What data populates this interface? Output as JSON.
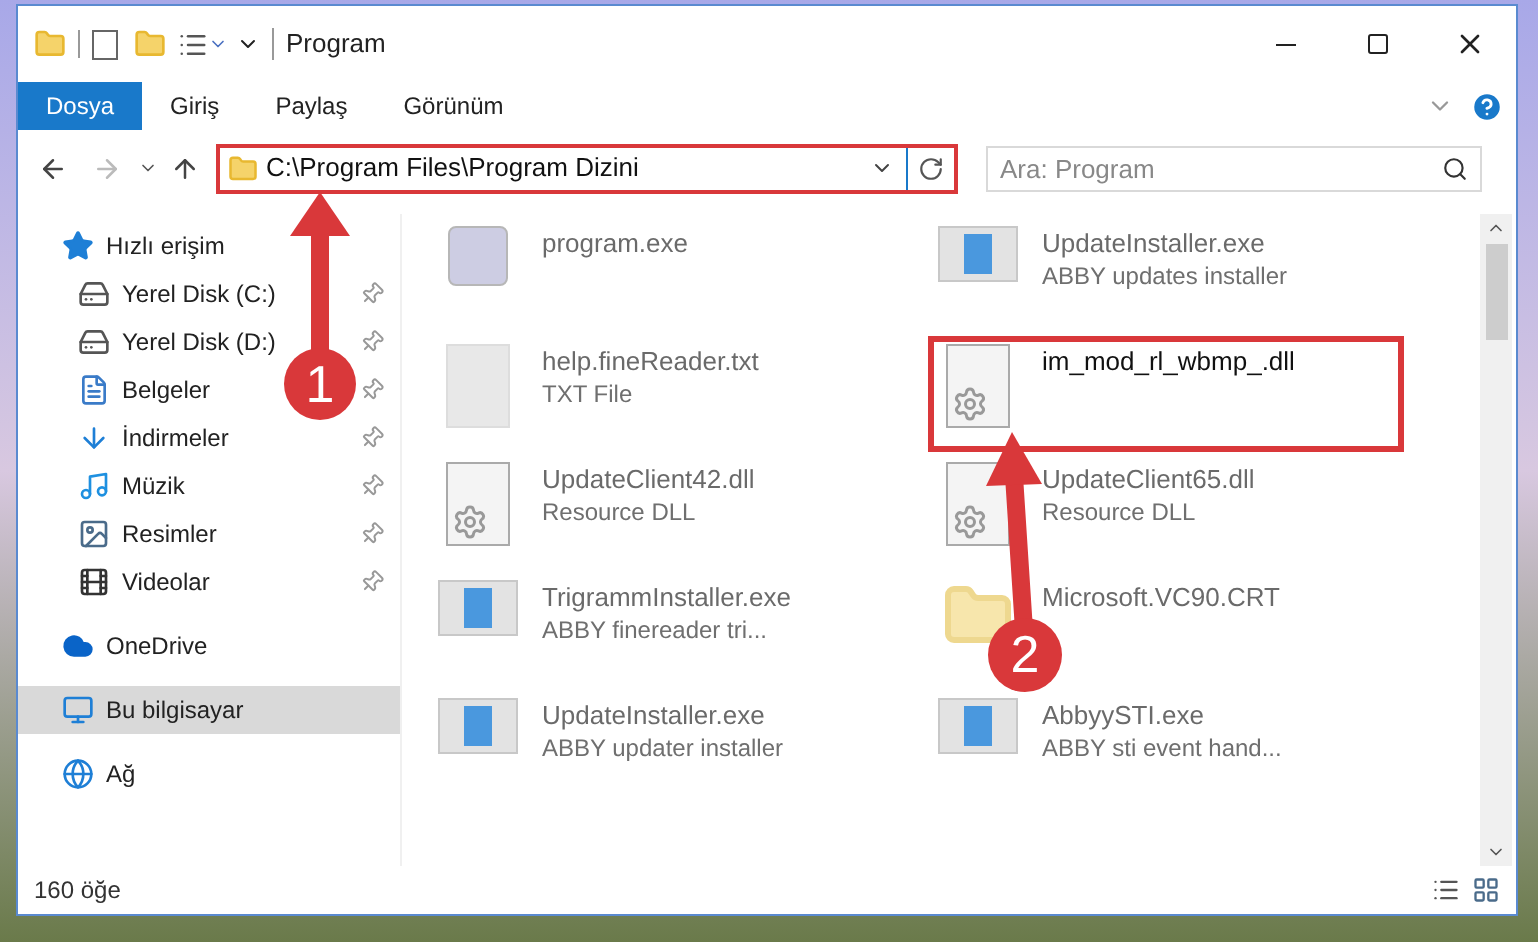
{
  "window": {
    "title": "Program"
  },
  "ribbon_tabs": [
    {
      "label": "Dosya",
      "selected": true
    },
    {
      "label": "Giriş",
      "selected": false
    },
    {
      "label": "Paylaş",
      "selected": false
    },
    {
      "label": "Görünüm",
      "selected": false
    }
  ],
  "address": {
    "path": "C:\\Program Files\\Program Dizini",
    "marked": true
  },
  "search": {
    "placeholder": "Ara: Program"
  },
  "nav": [
    {
      "label": "Hızlı erişim",
      "kind": "star",
      "selected": false,
      "children": [
        {
          "label": "Yerel Disk (C:)",
          "kind": "drive",
          "pinned": true,
          "selected": false
        },
        {
          "label": "Yerel Disk (D:)",
          "kind": "drive",
          "pinned": true,
          "selected": false
        },
        {
          "label": "Belgeler",
          "kind": "document",
          "pinned": true,
          "selected": false
        },
        {
          "label": "İndirmeler",
          "kind": "download",
          "pinned": true,
          "selected": false
        },
        {
          "label": "Müzik",
          "kind": "music",
          "pinned": true,
          "selected": false
        },
        {
          "label": "Resimler",
          "kind": "picture",
          "pinned": true,
          "selected": false
        },
        {
          "label": "Videolar",
          "kind": "film",
          "pinned": true,
          "selected": false
        }
      ]
    },
    {
      "label": "OneDrive",
      "kind": "cloud",
      "selected": false
    },
    {
      "label": "Bu bilgisayar",
      "kind": "computer",
      "selected": true
    },
    {
      "label": "Ağ",
      "kind": "network",
      "selected": false
    }
  ],
  "files": [
    {
      "name": "program.exe",
      "kind": "app",
      "marked": false
    },
    {
      "name": "UpdateInstaller.exe",
      "type": "ABBY updates installer",
      "kind": "installer",
      "marked": false
    },
    {
      "name": "help.fineReader.txt",
      "type": "TXT File",
      "kind": "text",
      "marked": false
    },
    {
      "name": "im_mod_rl_wbmp_.dll",
      "kind": "dll",
      "marked": true
    },
    {
      "name": "UpdateClient42.dll",
      "type": "Resource DLL",
      "kind": "dll",
      "marked": false
    },
    {
      "name": "UpdateClient65.dll",
      "type": "Resource DLL",
      "kind": "dll",
      "marked": false
    },
    {
      "name": "TrigrammInstaller.exe",
      "type": "ABBY finereader tri...",
      "kind": "installer",
      "marked": false
    },
    {
      "name": "Microsoft.VC90.CRT",
      "kind": "folder",
      "marked": false
    },
    {
      "name": "UpdateInstaller.exe",
      "type": "ABBY updater installer",
      "kind": "installer",
      "marked": false
    },
    {
      "name": "AbbyySTI.exe",
      "type": "ABBY sti event hand...",
      "kind": "installer",
      "marked": false
    }
  ],
  "status_bar": {
    "count": "160 öğe"
  },
  "annotations": [
    {
      "number": "1"
    },
    {
      "number": "2"
    }
  ]
}
